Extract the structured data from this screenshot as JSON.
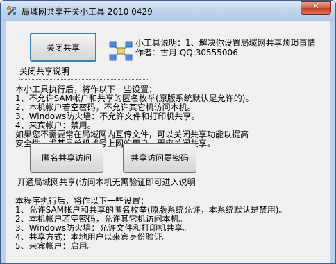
{
  "window": {
    "title": "局域网共享开关小工具 2010 0429",
    "close_glyph": "✕"
  },
  "buttons": {
    "close_share": "关闭共享",
    "anon_access": "匿名共享访问",
    "pwd_access": "共享访问要密码"
  },
  "info": {
    "description": "小工具说明：1、解决你设置局域网共享烦琐事情",
    "author": "作者：古月 QQ:30555006"
  },
  "close_section": {
    "heading": "关闭共享说明",
    "separator": "......................................................................",
    "lines": [
      "本小工具执行后，将作以下一些设置：",
      "1、不允许SAM帐户和共享的匿名枚举(原版系统默认是允许的)。",
      "2、本机帐户若空密码，不允许其它机访问本机。",
      "3、Windows防火墙：不允许文件和打印机共享。",
      "4、来宾帐户：禁用。",
      " 如果您不需要常在局域网内互传文件，可以关闭共享功能以提高",
      "安全性，尤其是单机拨号上网的用户，更应关闭共享。"
    ]
  },
  "open_section": {
    "heading": "开通局域网共享(访问本机无需验证即可进入说明",
    "separator": "......................................................................",
    "lines": [
      "本程序执行后，将作以下一些设置：",
      "1、允许SAM帐户和共享的匿名枚举(原版系统允许，本系统默认是禁用)。",
      "2、本机帐户若空密码，允许其它机访问本机。",
      "3、Windows防火墙：允许文件和打印机共享。",
      "4、共享方式：本地用户以来宾身份验证。",
      "5、来宾帐户：启用。"
    ]
  }
}
